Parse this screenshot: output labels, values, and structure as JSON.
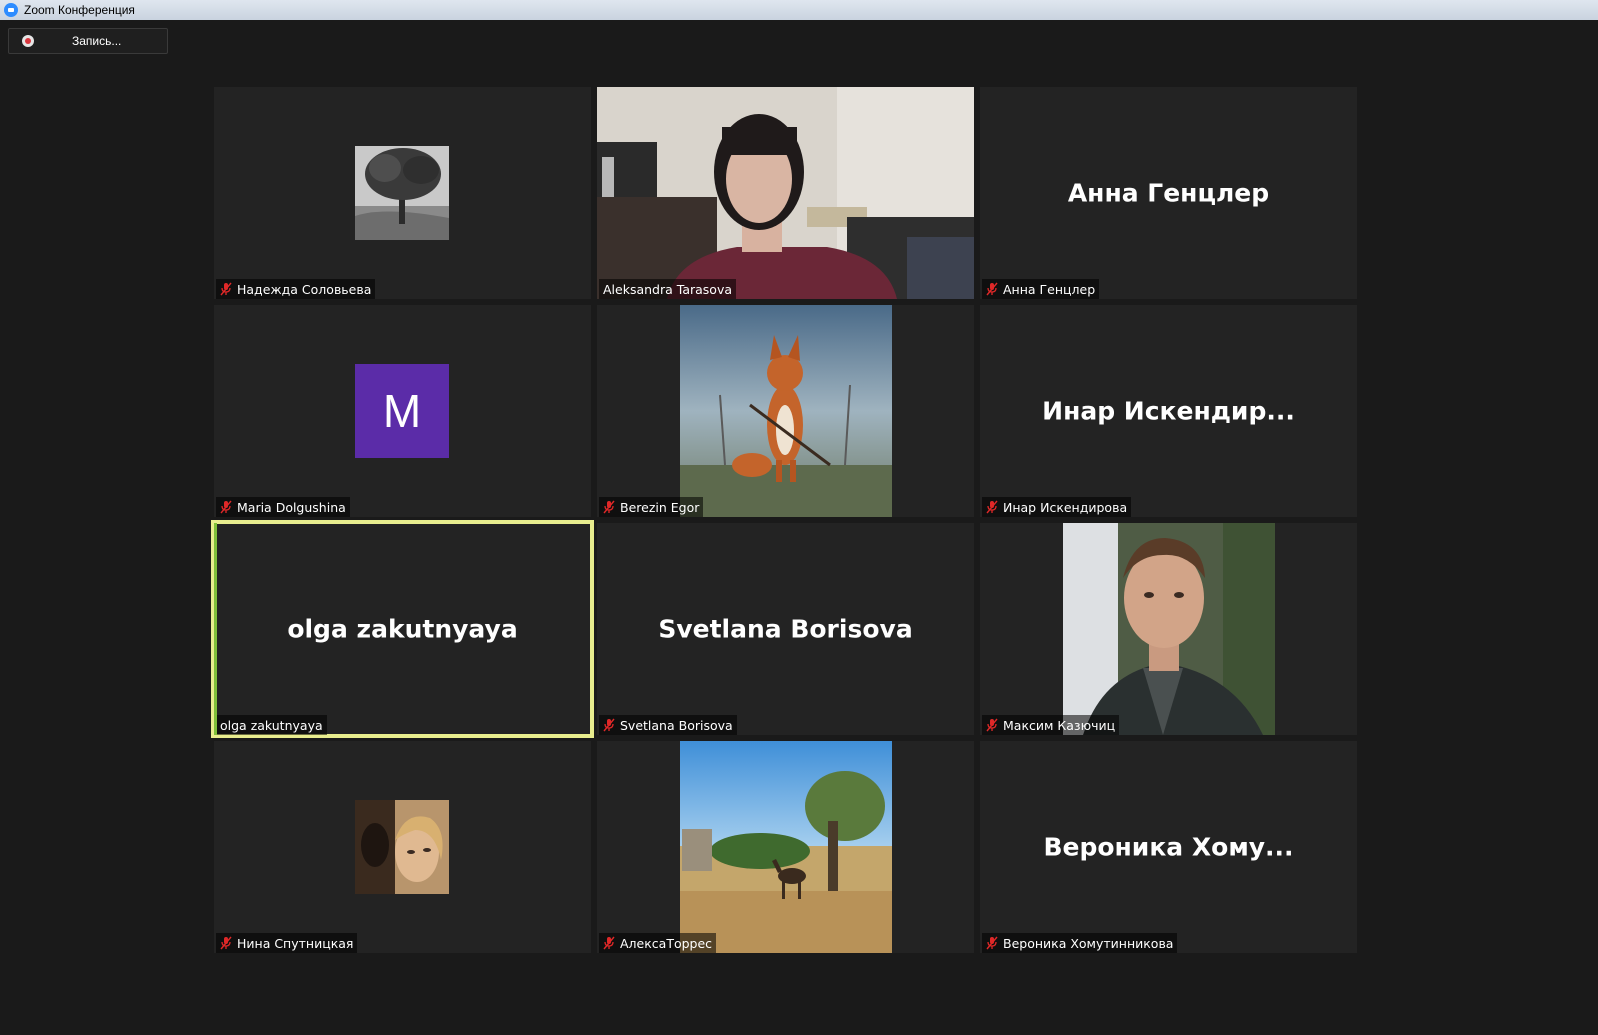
{
  "window": {
    "title": "Zoom Конференция"
  },
  "recording": {
    "label": "Запись..."
  },
  "participants": [
    {
      "name": "Надежда Соловьева",
      "muted": true,
      "display": "photo",
      "photo": "tree-photo"
    },
    {
      "name": "Aleksandra Tarasova",
      "muted": false,
      "display": "video"
    },
    {
      "name": "Анна Генцлер",
      "muted": true,
      "display": "name",
      "big_name": "Анна Генцлер"
    },
    {
      "name": "Maria Dolgushina",
      "muted": true,
      "display": "avatar",
      "avatar_letter": "M",
      "avatar_color": "#5b2ca8"
    },
    {
      "name": "Berezin Egor",
      "muted": true,
      "display": "photo",
      "photo": "fox-illustration"
    },
    {
      "name": "Инар Искендирова",
      "muted": true,
      "display": "name",
      "big_name": "Инар  Искендир..."
    },
    {
      "name": "olga zakutnyaya",
      "muted": false,
      "display": "name",
      "big_name": "olga zakutnyaya",
      "active_speaker": true
    },
    {
      "name": "Svetlana Borisova",
      "muted": true,
      "display": "name",
      "big_name": "Svetlana Borisova"
    },
    {
      "name": "Максим Казючиц",
      "muted": true,
      "display": "photo",
      "photo": "man-portrait"
    },
    {
      "name": "Нина Спутницкая",
      "muted": true,
      "display": "photo",
      "photo": "woman-portrait"
    },
    {
      "name": "АлексаТоррес",
      "muted": true,
      "display": "photo",
      "photo": "camel-landscape"
    },
    {
      "name": "Вероника Хомутинникова",
      "muted": true,
      "display": "name",
      "big_name": "Вероника  Хому..."
    }
  ],
  "colors": {
    "background": "#1a1a1a",
    "tile": "#232323",
    "active_border": "#e8ed8e",
    "mute_red": "#e02828"
  }
}
